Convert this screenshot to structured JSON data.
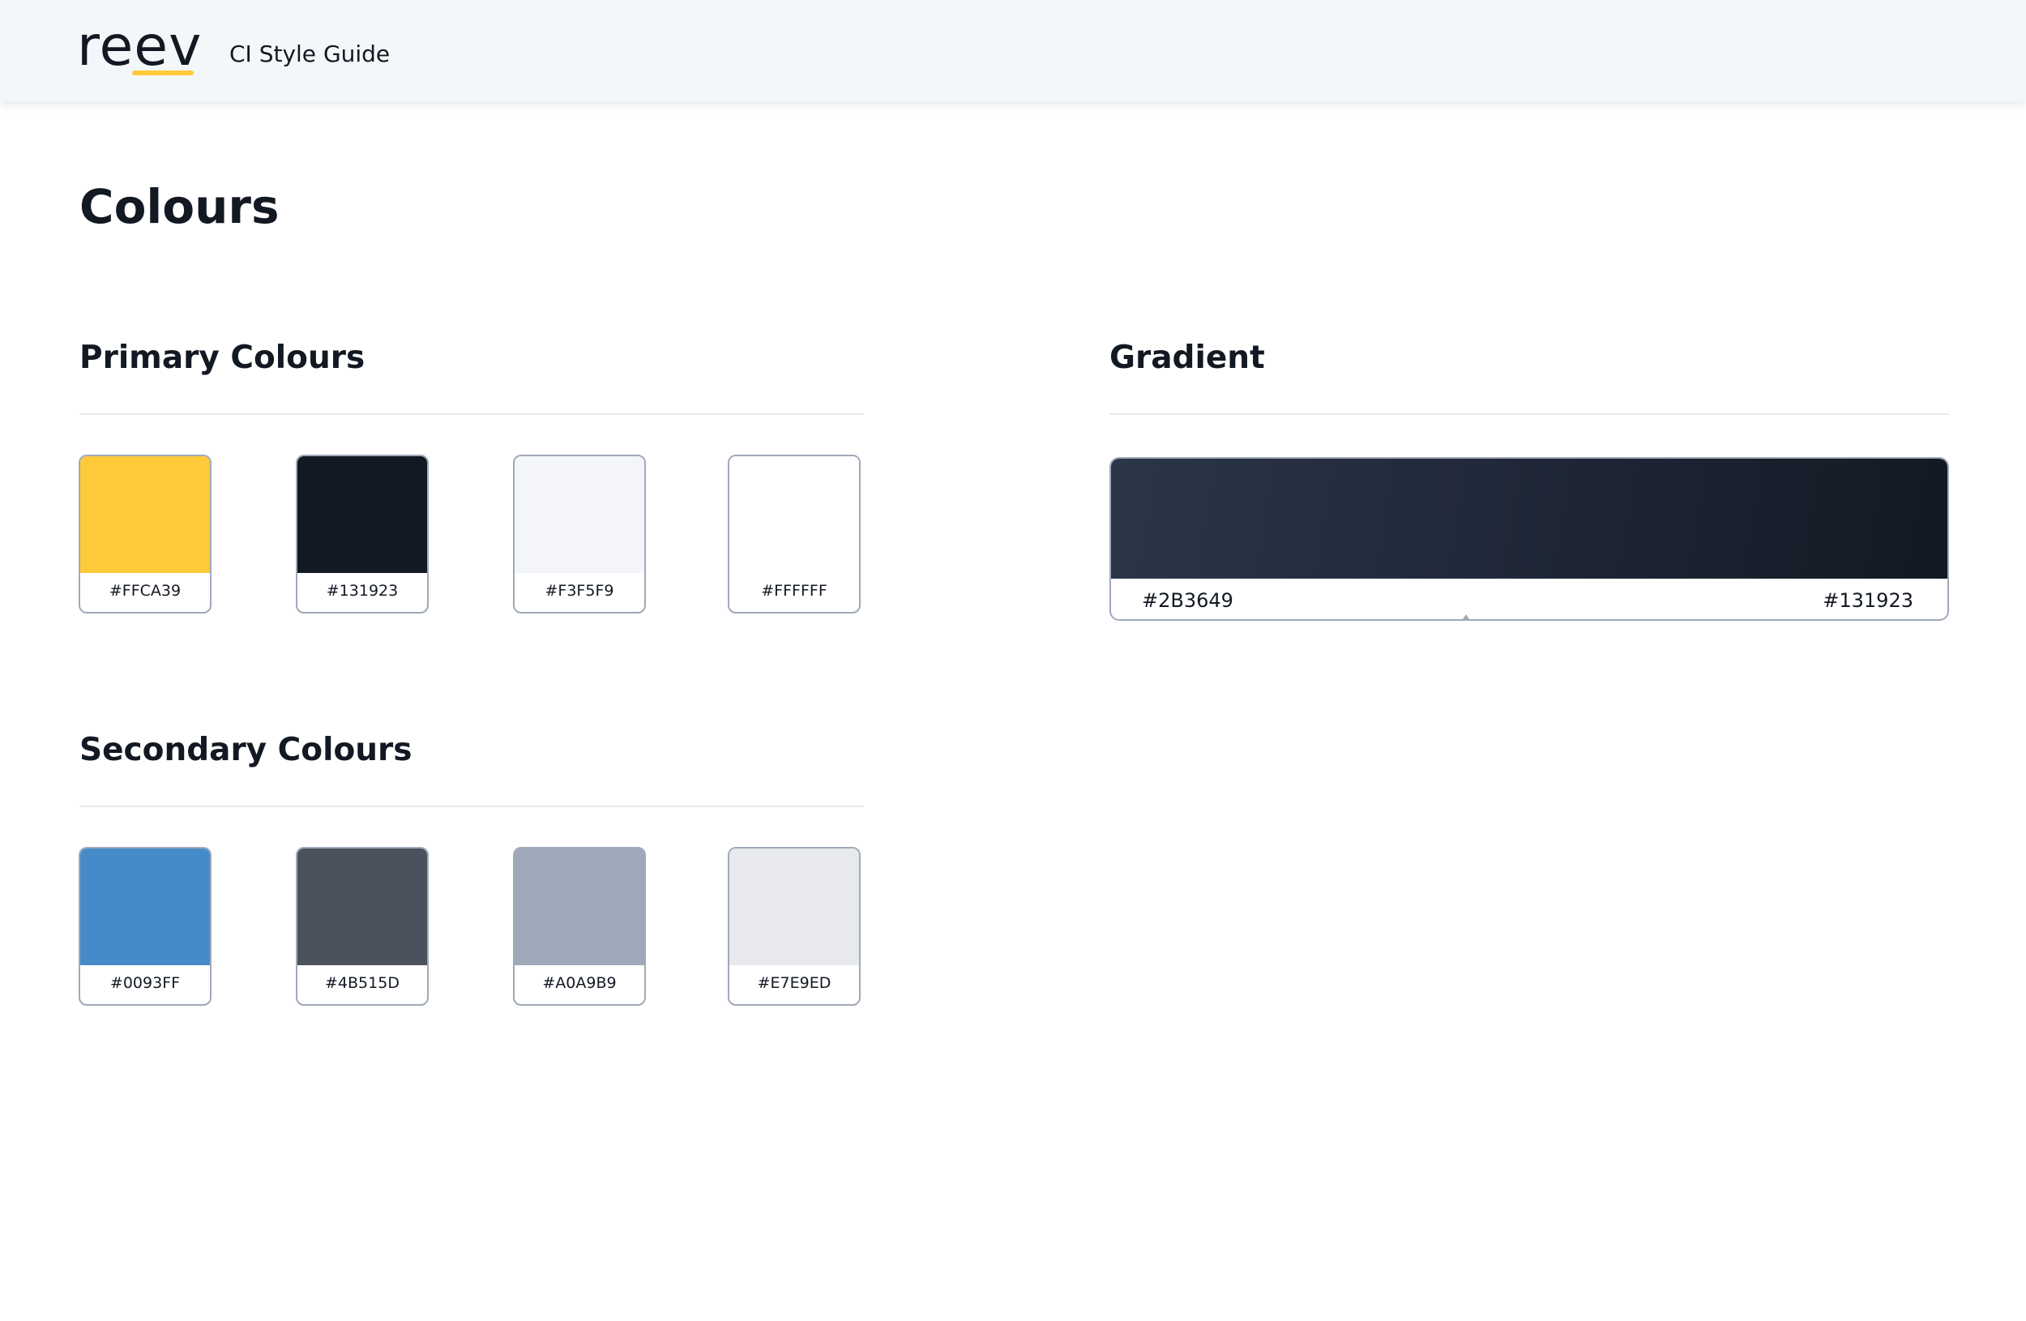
{
  "header": {
    "logo_text": "reev",
    "app_title": "CI Style Guide"
  },
  "page": {
    "title": "Colours"
  },
  "primary": {
    "title": "Primary Colours",
    "swatches": [
      {
        "hex": "#FFCA39",
        "color": "#FFCA39"
      },
      {
        "hex": "#131923",
        "color": "#131923"
      },
      {
        "hex": "#F3F5F9",
        "color": "#F3F5F9"
      },
      {
        "hex": "#FFFFFF",
        "color": "#FFFFFF"
      }
    ]
  },
  "secondary": {
    "title": "Secondary Colours",
    "swatches": [
      {
        "hex": "#0093FF",
        "color": "#468BC9"
      },
      {
        "hex": "#4B515D",
        "color": "#4B515D"
      },
      {
        "hex": "#A0A9B9",
        "color": "#A0A9B9"
      },
      {
        "hex": "#E7E9ED",
        "color": "#E7E9ED"
      }
    ]
  },
  "gradient": {
    "title": "Gradient",
    "start_hex": "#2B3649",
    "end_hex": "#131923"
  }
}
